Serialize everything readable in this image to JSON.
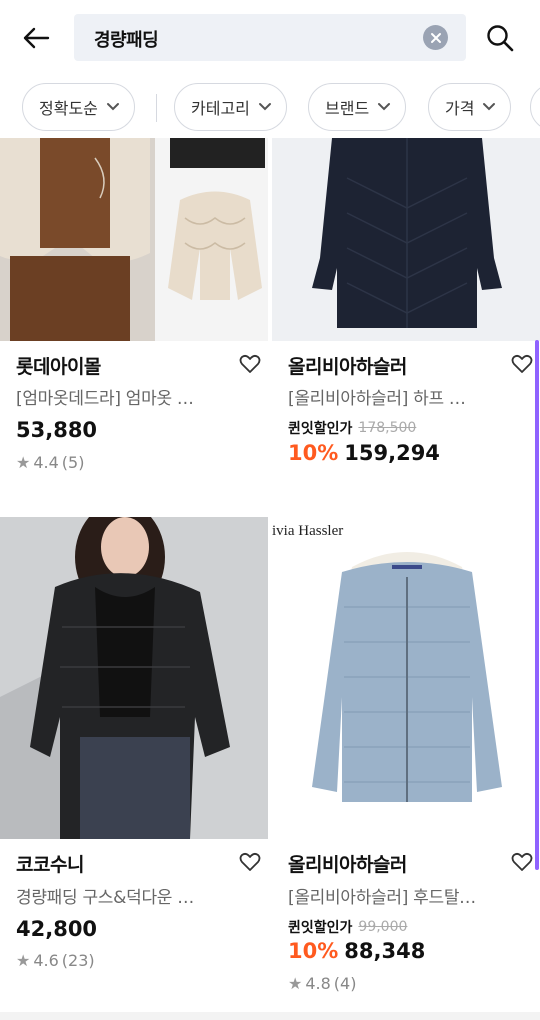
{
  "search": {
    "query": "경량패딩"
  },
  "filters": [
    {
      "label": "정확도순"
    },
    {
      "label": "카테고리"
    },
    {
      "label": "브랜드"
    },
    {
      "label": "가격"
    }
  ],
  "products": [
    {
      "brand": "롯데아이몰",
      "title": "[엄마옷데드라] 엄마옷 …",
      "price": "53,880",
      "rating": "4.4",
      "reviews": "(5)"
    },
    {
      "brand": "올리비아하슬러",
      "title": "[올리비아하슬러] 하프 …",
      "promo_label": "퀸잇할인가",
      "original_price": "178,500",
      "discount": "10%",
      "price": "159,294"
    },
    {
      "brand": "코코수니",
      "title": "경량패딩 구스&덕다운 …",
      "price": "42,800",
      "rating": "4.6",
      "reviews": "(23)"
    },
    {
      "brand": "올리비아하슬러",
      "title": "[올리비아하슬러] 후드탈…",
      "promo_label": "퀸잇할인가",
      "original_price": "99,000",
      "discount": "10%",
      "price": "88,348",
      "rating": "4.8",
      "reviews": "(4)",
      "image_text": "ivia Hassler"
    }
  ],
  "colors": {
    "accent": "#ff5a1f",
    "scroll": "#8f62ff",
    "search_bg": "#eef1f6"
  }
}
